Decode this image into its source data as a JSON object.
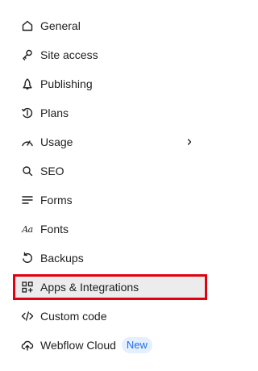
{
  "nav": {
    "items": [
      {
        "label": "General",
        "icon": "home-icon"
      },
      {
        "label": "Site access",
        "icon": "key-icon"
      },
      {
        "label": "Publishing",
        "icon": "rocket-icon"
      },
      {
        "label": "Plans",
        "icon": "plan-icon"
      },
      {
        "label": "Usage",
        "icon": "gauge-icon"
      },
      {
        "label": "SEO",
        "icon": "search-icon"
      },
      {
        "label": "Forms",
        "icon": "forms-icon"
      },
      {
        "label": "Fonts",
        "icon": "fonts-icon",
        "glyph": "Aa"
      },
      {
        "label": "Backups",
        "icon": "restore-icon"
      },
      {
        "label": "Apps & Integrations",
        "icon": "apps-icon",
        "active": true
      },
      {
        "label": "Custom code",
        "icon": "code-icon"
      },
      {
        "label": "Webflow Cloud",
        "icon": "cloud-icon",
        "badge": "New"
      }
    ]
  },
  "colors": {
    "highlight_border": "#e3000f",
    "active_background": "#ececec",
    "badge_background": "#e4efff",
    "badge_text": "#1f6fe8"
  }
}
